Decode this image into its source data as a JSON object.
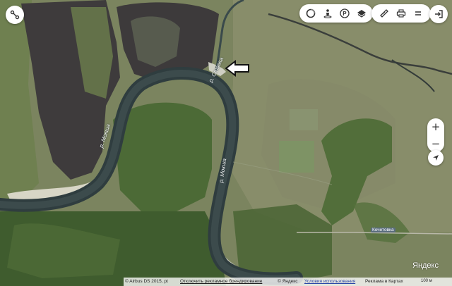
{
  "map": {
    "river_labels": [
      "р. Мокша",
      "р. Мокша"
    ],
    "stream_label": "р. Ставка",
    "road_label": "Кочетовка",
    "river_color": "#2f3d3f",
    "burned_color": "#3e3b3c"
  },
  "toolbar": {
    "left_button_icon": "route-icon",
    "layers_icons": [
      "traffic-icon",
      "panorama-person-icon",
      "parking-icon",
      "layers-icon"
    ],
    "tools_icons": [
      "ruler-icon",
      "print-icon",
      "menu-icon"
    ],
    "exit_icon": "login-icon"
  },
  "zoom": {
    "in": "+",
    "out": "−"
  },
  "footer": {
    "copyright": "© Airbus DS 2015, pt",
    "disable_ads": "Отключить рекламное брендирование",
    "yandex_copy": "© Яндекс",
    "terms": "Условия использования",
    "ad": "Реклама в Картах"
  },
  "logo": "Яндекс",
  "scale": "100 м",
  "arrow_color": "#111111"
}
